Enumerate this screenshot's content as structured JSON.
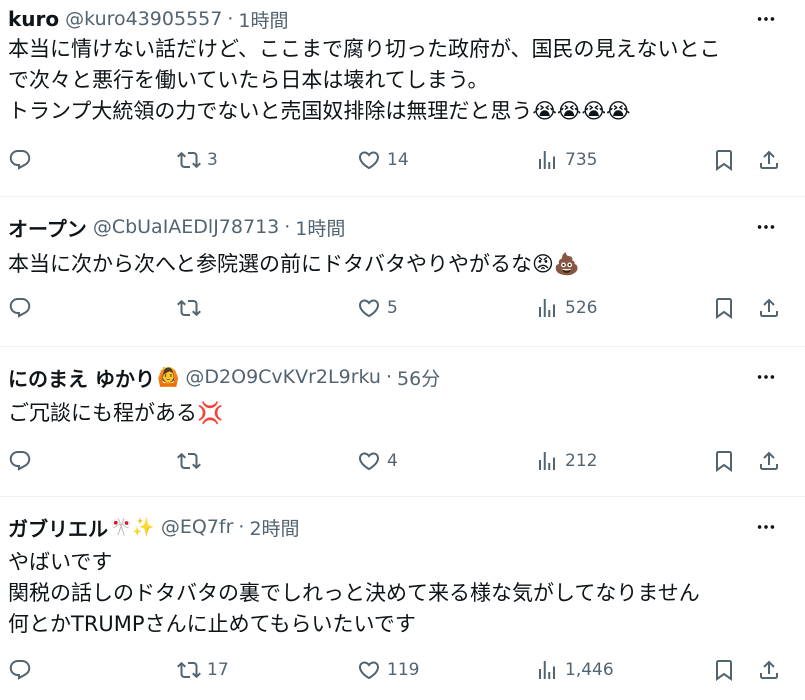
{
  "tweets": [
    {
      "name": "kuro",
      "handle": "@kuro43905557",
      "time": "1時間",
      "lines": [
        "本当に情けない話だけど、ここまで腐り切った政府が、国民の見えないとこ",
        "で次々と悪行を働いていたら日本は壊れてしまう。",
        "トランプ大統領の力でないと売国奴排除は無理だと思う😭😭😭😭"
      ],
      "replies": "",
      "retweets": "3",
      "likes": "14",
      "views": "735"
    },
    {
      "name": "オープン",
      "handle": "@CbUaIAEDlJ78713",
      "time": "1時間",
      "lines": [
        "本当に次から次へと参院選の前にドタバタやりやがるな😡💩"
      ],
      "replies": "",
      "retweets": "",
      "likes": "5",
      "views": "526"
    },
    {
      "name": "にのまえ ゆかり",
      "name_emoji": "🙆",
      "handle": "@D2O9CvKVr2L9rku",
      "time": "56分",
      "lines": [
        "ご冗談にも程がある💢"
      ],
      "replies": "",
      "retweets": "",
      "likes": "4",
      "views": "212"
    },
    {
      "name": "ガブリエル",
      "name_emoji": "🎌✨",
      "handle": "@EQ7fr",
      "time": "2時間",
      "lines": [
        "やばいです",
        "関税の話しのドタバタの裏でしれっと決めて来る様な気がしてなりません",
        "何とかTRUMPさんに止めてもらいたいです"
      ],
      "replies": "",
      "retweets": "17",
      "likes": "119",
      "views": "1,446"
    }
  ],
  "separator": "·",
  "icons": {
    "reply": "reply-icon",
    "retweet": "retweet-icon",
    "like": "heart-icon",
    "views": "views-icon",
    "bookmark": "bookmark-icon",
    "share": "share-icon",
    "more": "more-icon"
  },
  "colors": {
    "text": "#0f1419",
    "secondary": "#536471",
    "divider": "#eff3f4"
  }
}
